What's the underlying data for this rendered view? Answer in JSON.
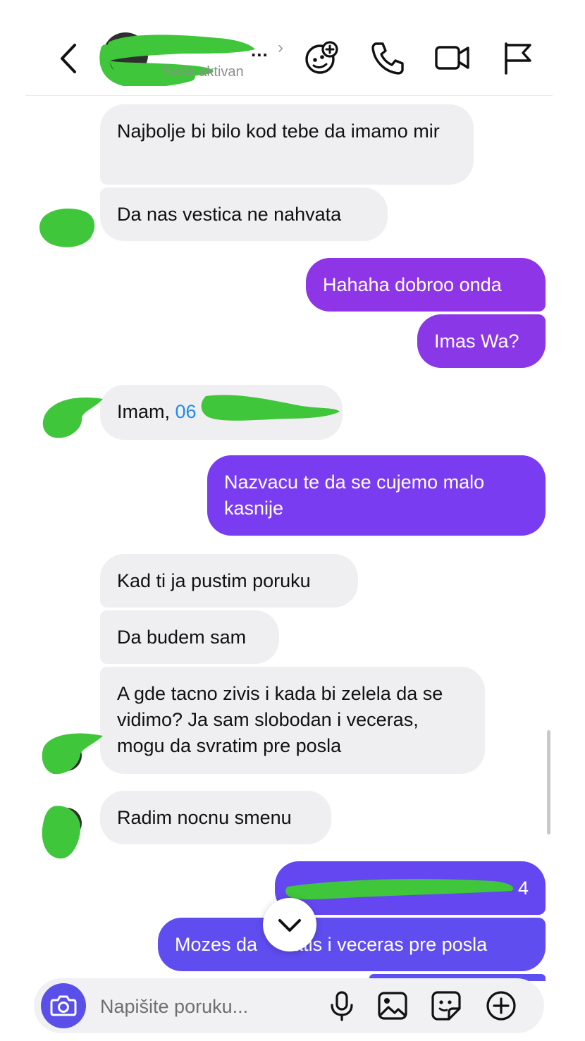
{
  "header": {
    "name_ellipsis": "...",
    "status": "Sada aktivan",
    "icons": [
      "back-icon",
      "chevron-right-icon",
      "effects-icon",
      "phone-icon",
      "video-icon",
      "flag-icon"
    ]
  },
  "messages": [
    {
      "dir": "in",
      "text": "Najbolje bi bilo kod tebe da imamo mir"
    },
    {
      "dir": "in",
      "text": "Da nas vestica ne nahvata"
    },
    {
      "dir": "out",
      "text": "Hahaha dobroo onda"
    },
    {
      "dir": "out",
      "text": "Imas Wa?"
    },
    {
      "dir": "in",
      "text_prefix": "Imam,",
      "text_link": "06"
    },
    {
      "dir": "out",
      "text": "Nazvacu te da se cujemo malo kasnije"
    },
    {
      "dir": "in",
      "text": "Kad ti ja pustim poruku"
    },
    {
      "dir": "in",
      "text": "Da budem sam"
    },
    {
      "dir": "in",
      "text": "A gde tacno zivis i kada bi zelela da se vidimo? Ja sam slobodan i veceras, mogu da svratim pre posla"
    },
    {
      "dir": "in",
      "text": "Radim nocnu smenu"
    },
    {
      "dir": "out",
      "text": "4"
    },
    {
      "dir": "out",
      "text_a": "Mozes da",
      "text_b": "atis i veceras pre posla"
    }
  ],
  "composer": {
    "placeholder": "Napišite poruku...",
    "icons": [
      "camera-icon",
      "microphone-icon",
      "gallery-icon",
      "sticker-icon",
      "add-icon"
    ]
  },
  "colors": {
    "incoming_bubble": "#efeff1",
    "outgoing_purple": "#8e35e8",
    "outgoing_violet": "#7a3cf0",
    "outgoing_indigo": "#5f4df0",
    "link": "#1d8bf1",
    "redaction": "#3fc63a",
    "camera_button": "#5b4fe9"
  }
}
